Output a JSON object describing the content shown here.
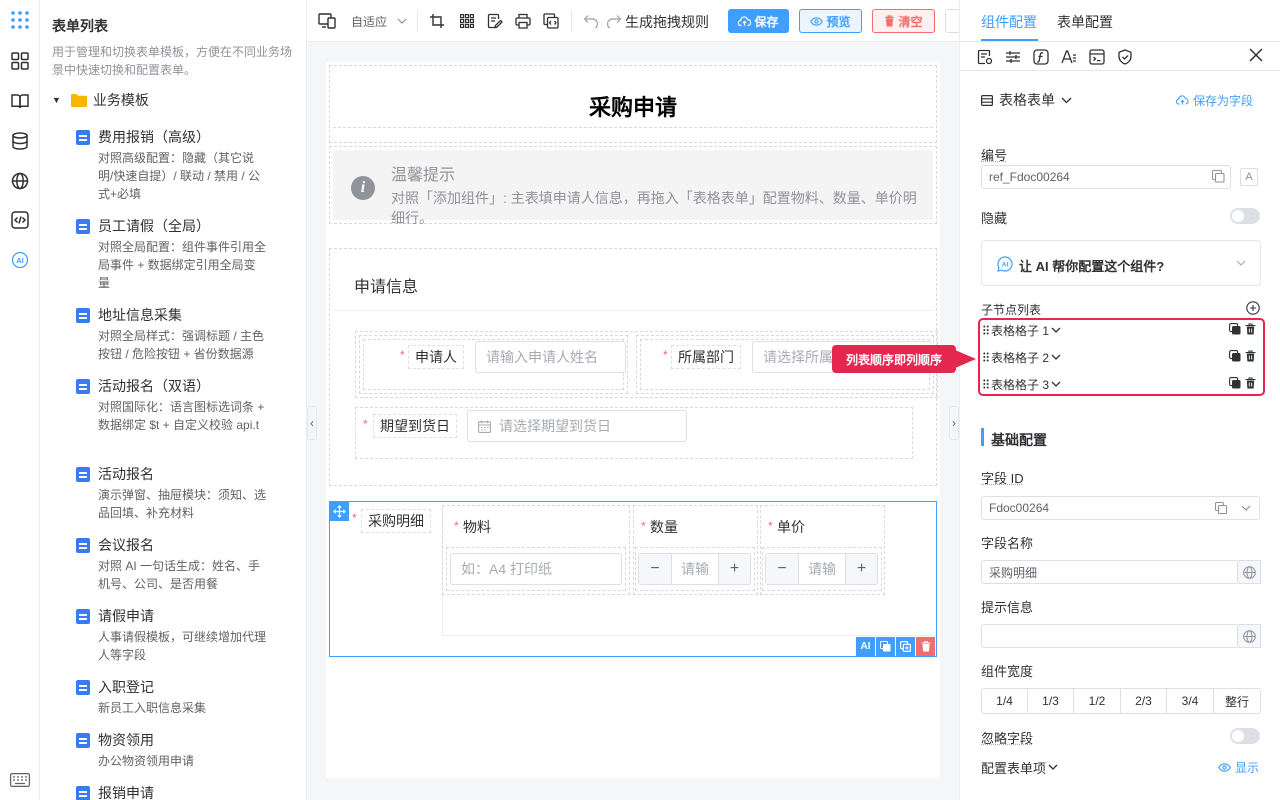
{
  "template_list": {
    "title": "表单列表",
    "description": "用于管理和切换表单模板，方便在不同业务场景中快速切换和配置表单。",
    "folder": "业务模板",
    "items": [
      {
        "name": "费用报销（高级）",
        "desc": "对照高级配置：隐藏（其它说明/快速自提）/ 联动 / 禁用 / 公式+必填"
      },
      {
        "name": "员工请假（全局）",
        "desc": "对照全局配置：组件事件引用全局事件 + 数据绑定引用全局变量"
      },
      {
        "name": "地址信息采集",
        "desc": "对照全局样式：强调标题 / 主色按钮 / 危险按钮 + 省份数据源"
      },
      {
        "name": "活动报名（双语）",
        "desc": "对照国际化：语言图标选词条 + 数据绑定 $t + 自定义校验 api.t"
      },
      {
        "name": "活动报名",
        "desc": "演示弹窗、抽屉模块：须知、选品回填、补充材料"
      },
      {
        "name": "会议报名",
        "desc": "对照 AI 一句话生成：姓名、手机号、公司、是否用餐"
      },
      {
        "name": "请假申请",
        "desc": "人事请假模板，可继续增加代理人等字段"
      },
      {
        "name": "入职登记",
        "desc": "新员工入职信息采集"
      },
      {
        "name": "物资领用",
        "desc": "办公物资领用申请"
      },
      {
        "name": "报销申请",
        "desc": ""
      }
    ]
  },
  "toolbar": {
    "adapt_label": "自适应",
    "gen_rule_label": "生成拖拽规则",
    "save_label": "保存",
    "preview_label": "预览",
    "clear_label": "清空"
  },
  "form": {
    "title": "采购申请",
    "alert_title": "温馨提示",
    "alert_text": "对照「添加组件」: 主表填申请人信息，再拖入「表格表单」配置物料、数量、单价明细行。",
    "section_title": "申请信息",
    "applicant_label": "申请人",
    "applicant_placeholder": "请输入申请人姓名",
    "dept_label": "所属部门",
    "dept_placeholder": "请选择所属部门",
    "date_label": "期望到货日",
    "date_placeholder": "请选择期望到货日",
    "detail_label": "采购明细",
    "col_material": "物料",
    "col_qty": "数量",
    "col_price": "单价",
    "material_placeholder": "如：A4 打印纸",
    "qty_placeholder": "请输",
    "price_placeholder": "请输",
    "minus": "−",
    "plus": "+"
  },
  "right_panel": {
    "tabs": [
      "组件配置",
      "表单配置"
    ],
    "component_type": "表格表单",
    "save_as_field": "保存为字段",
    "id_label": "编号",
    "id_value": "ref_Fdoc00264",
    "hidden_label": "隐藏",
    "ai_prompt": "让 AI 帮你配置这个组件?",
    "children_label": "子节点列表",
    "children": [
      "表格格子 1",
      "表格格子 2",
      "表格格子 3"
    ],
    "callout": "列表顺序即列顺序",
    "basic_section": "基础配置",
    "field_id_label": "字段 ID",
    "field_id_value": "Fdoc00264",
    "field_name_label": "字段名称",
    "field_name_value": "采购明细",
    "hint_label": "提示信息",
    "hint_value": "",
    "width_label": "组件宽度",
    "width_options": [
      "1/4",
      "1/3",
      "1/2",
      "2/3",
      "3/4",
      "整行"
    ],
    "ignore_label": "忽略字段",
    "config_items_label": "配置表单项",
    "show_label": "显示"
  },
  "colors": {
    "primary": "#409eff",
    "danger": "#f56c6c",
    "highlight": "#e5264e"
  }
}
